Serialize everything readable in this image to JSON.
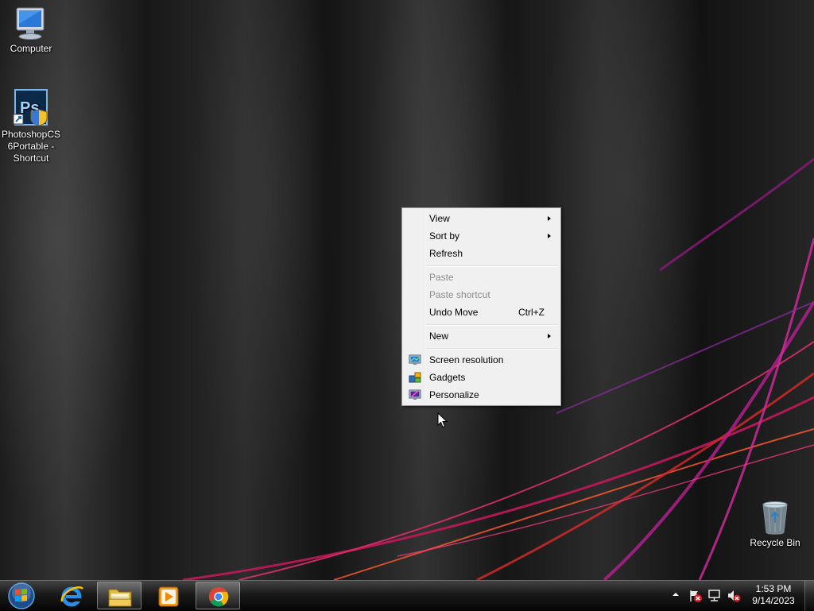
{
  "desktop": {
    "icons": [
      {
        "label": "Computer"
      },
      {
        "label": "PhotoshopCS 6Portable - Shortcut"
      },
      {
        "label": "Recycle Bin"
      }
    ]
  },
  "context_menu": {
    "items": [
      {
        "label": "View",
        "submenu": true
      },
      {
        "label": "Sort by",
        "submenu": true
      },
      {
        "label": "Refresh"
      },
      {
        "label": "Paste",
        "disabled": true
      },
      {
        "label": "Paste shortcut",
        "disabled": true
      },
      {
        "label": "Undo Move",
        "shortcut": "Ctrl+Z"
      },
      {
        "label": "New",
        "submenu": true
      },
      {
        "label": "Screen resolution",
        "icon": "monitor-icon"
      },
      {
        "label": "Gadgets",
        "icon": "gadgets-icon"
      },
      {
        "label": "Personalize",
        "icon": "personalize-icon"
      }
    ]
  },
  "taskbar": {
    "start_icon": "windows-logo-icon",
    "pinned": [
      {
        "name": "Internet Explorer",
        "icon": "internet-explorer-icon"
      },
      {
        "name": "Windows Explorer",
        "icon": "folder-icon"
      },
      {
        "name": "Windows Media Player",
        "icon": "media-player-icon"
      },
      {
        "name": "Google Chrome",
        "icon": "chrome-icon",
        "active": true
      }
    ],
    "tray": {
      "icons": [
        "show-hidden-icons-arrow",
        "action-center-flag-icon",
        "network-icon",
        "volume-muted-icon"
      ],
      "time": "1:53 PM",
      "date": "9/14/2023"
    }
  },
  "colors": {
    "menu_bg": "#f0f0f0",
    "menu_border": "#979797",
    "disabled_text": "#8d8d8d",
    "desktop_accent": "#d0208c"
  }
}
